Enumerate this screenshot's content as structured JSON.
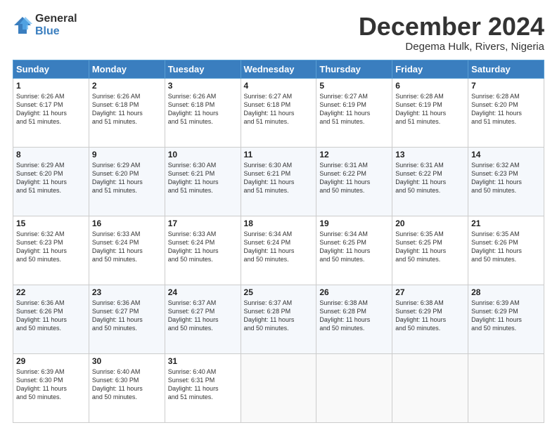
{
  "header": {
    "logo_general": "General",
    "logo_blue": "Blue",
    "title": "December 2024",
    "subtitle": "Degema Hulk, Rivers, Nigeria"
  },
  "calendar": {
    "headers": [
      "Sunday",
      "Monday",
      "Tuesday",
      "Wednesday",
      "Thursday",
      "Friday",
      "Saturday"
    ],
    "weeks": [
      [
        {
          "day": "",
          "info": ""
        },
        {
          "day": "2",
          "info": "Sunrise: 6:26 AM\nSunset: 6:18 PM\nDaylight: 11 hours\nand 51 minutes."
        },
        {
          "day": "3",
          "info": "Sunrise: 6:26 AM\nSunset: 6:18 PM\nDaylight: 11 hours\nand 51 minutes."
        },
        {
          "day": "4",
          "info": "Sunrise: 6:27 AM\nSunset: 6:18 PM\nDaylight: 11 hours\nand 51 minutes."
        },
        {
          "day": "5",
          "info": "Sunrise: 6:27 AM\nSunset: 6:19 PM\nDaylight: 11 hours\nand 51 minutes."
        },
        {
          "day": "6",
          "info": "Sunrise: 6:28 AM\nSunset: 6:19 PM\nDaylight: 11 hours\nand 51 minutes."
        },
        {
          "day": "7",
          "info": "Sunrise: 6:28 AM\nSunset: 6:20 PM\nDaylight: 11 hours\nand 51 minutes."
        }
      ],
      [
        {
          "day": "1",
          "info": "Sunrise: 6:26 AM\nSunset: 6:17 PM\nDaylight: 11 hours\nand 51 minutes."
        },
        {
          "day": "",
          "info": ""
        },
        {
          "day": "",
          "info": ""
        },
        {
          "day": "",
          "info": ""
        },
        {
          "day": "",
          "info": ""
        },
        {
          "day": "",
          "info": ""
        },
        {
          "day": "",
          "info": ""
        }
      ],
      [
        {
          "day": "8",
          "info": "Sunrise: 6:29 AM\nSunset: 6:20 PM\nDaylight: 11 hours\nand 51 minutes."
        },
        {
          "day": "9",
          "info": "Sunrise: 6:29 AM\nSunset: 6:20 PM\nDaylight: 11 hours\nand 51 minutes."
        },
        {
          "day": "10",
          "info": "Sunrise: 6:30 AM\nSunset: 6:21 PM\nDaylight: 11 hours\nand 51 minutes."
        },
        {
          "day": "11",
          "info": "Sunrise: 6:30 AM\nSunset: 6:21 PM\nDaylight: 11 hours\nand 51 minutes."
        },
        {
          "day": "12",
          "info": "Sunrise: 6:31 AM\nSunset: 6:22 PM\nDaylight: 11 hours\nand 50 minutes."
        },
        {
          "day": "13",
          "info": "Sunrise: 6:31 AM\nSunset: 6:22 PM\nDaylight: 11 hours\nand 50 minutes."
        },
        {
          "day": "14",
          "info": "Sunrise: 6:32 AM\nSunset: 6:23 PM\nDaylight: 11 hours\nand 50 minutes."
        }
      ],
      [
        {
          "day": "15",
          "info": "Sunrise: 6:32 AM\nSunset: 6:23 PM\nDaylight: 11 hours\nand 50 minutes."
        },
        {
          "day": "16",
          "info": "Sunrise: 6:33 AM\nSunset: 6:24 PM\nDaylight: 11 hours\nand 50 minutes."
        },
        {
          "day": "17",
          "info": "Sunrise: 6:33 AM\nSunset: 6:24 PM\nDaylight: 11 hours\nand 50 minutes."
        },
        {
          "day": "18",
          "info": "Sunrise: 6:34 AM\nSunset: 6:24 PM\nDaylight: 11 hours\nand 50 minutes."
        },
        {
          "day": "19",
          "info": "Sunrise: 6:34 AM\nSunset: 6:25 PM\nDaylight: 11 hours\nand 50 minutes."
        },
        {
          "day": "20",
          "info": "Sunrise: 6:35 AM\nSunset: 6:25 PM\nDaylight: 11 hours\nand 50 minutes."
        },
        {
          "day": "21",
          "info": "Sunrise: 6:35 AM\nSunset: 6:26 PM\nDaylight: 11 hours\nand 50 minutes."
        }
      ],
      [
        {
          "day": "22",
          "info": "Sunrise: 6:36 AM\nSunset: 6:26 PM\nDaylight: 11 hours\nand 50 minutes."
        },
        {
          "day": "23",
          "info": "Sunrise: 6:36 AM\nSunset: 6:27 PM\nDaylight: 11 hours\nand 50 minutes."
        },
        {
          "day": "24",
          "info": "Sunrise: 6:37 AM\nSunset: 6:27 PM\nDaylight: 11 hours\nand 50 minutes."
        },
        {
          "day": "25",
          "info": "Sunrise: 6:37 AM\nSunset: 6:28 PM\nDaylight: 11 hours\nand 50 minutes."
        },
        {
          "day": "26",
          "info": "Sunrise: 6:38 AM\nSunset: 6:28 PM\nDaylight: 11 hours\nand 50 minutes."
        },
        {
          "day": "27",
          "info": "Sunrise: 6:38 AM\nSunset: 6:29 PM\nDaylight: 11 hours\nand 50 minutes."
        },
        {
          "day": "28",
          "info": "Sunrise: 6:39 AM\nSunset: 6:29 PM\nDaylight: 11 hours\nand 50 minutes."
        }
      ],
      [
        {
          "day": "29",
          "info": "Sunrise: 6:39 AM\nSunset: 6:30 PM\nDaylight: 11 hours\nand 50 minutes."
        },
        {
          "day": "30",
          "info": "Sunrise: 6:40 AM\nSunset: 6:30 PM\nDaylight: 11 hours\nand 50 minutes."
        },
        {
          "day": "31",
          "info": "Sunrise: 6:40 AM\nSunset: 6:31 PM\nDaylight: 11 hours\nand 51 minutes."
        },
        {
          "day": "",
          "info": ""
        },
        {
          "day": "",
          "info": ""
        },
        {
          "day": "",
          "info": ""
        },
        {
          "day": "",
          "info": ""
        }
      ]
    ]
  }
}
